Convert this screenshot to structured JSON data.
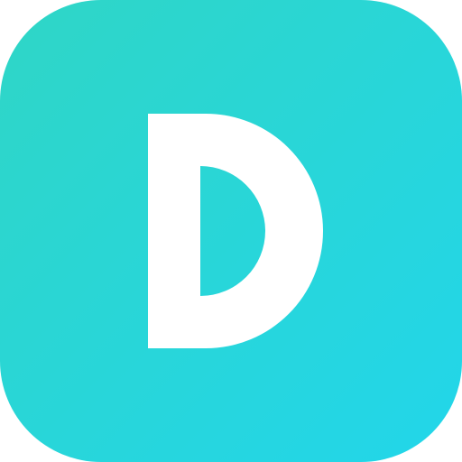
{
  "icon": {
    "name": "app-icon",
    "letter": "D",
    "colors": {
      "gradient_start": "#2fd6c6",
      "gradient_end": "#22d6ea",
      "glyph": "#ffffff"
    }
  }
}
